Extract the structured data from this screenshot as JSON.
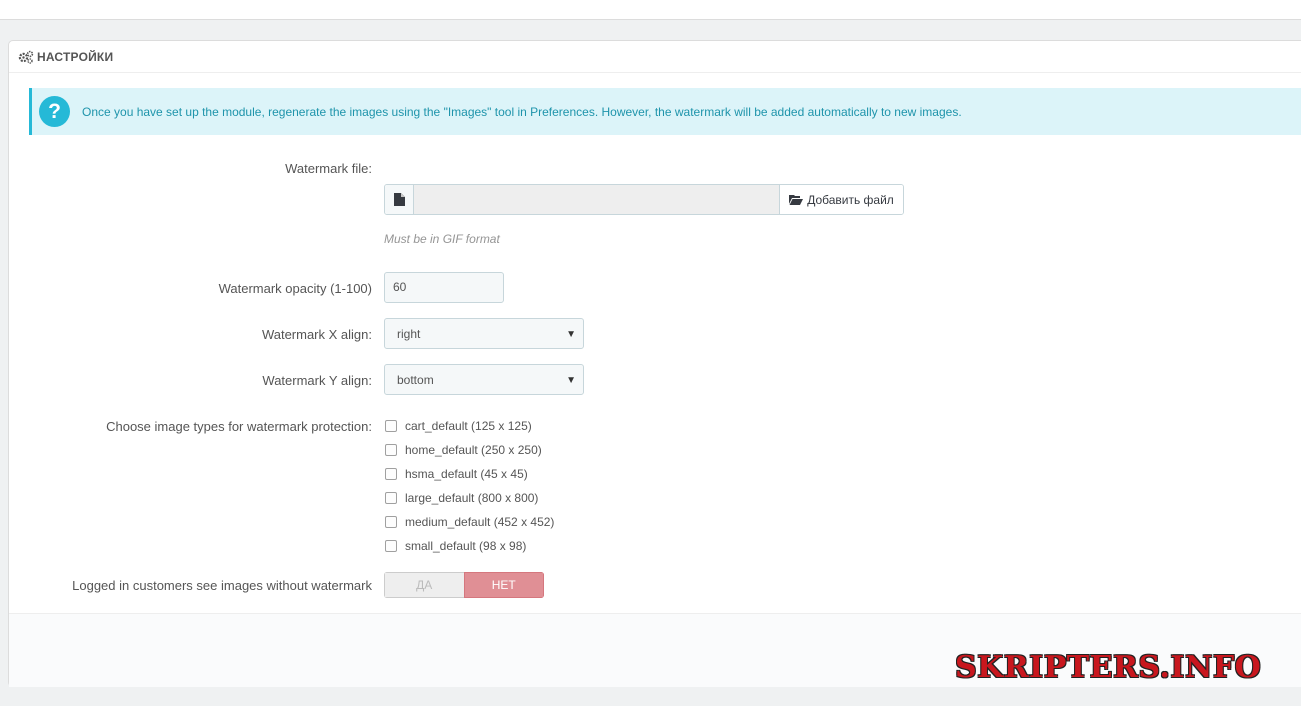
{
  "panel": {
    "title": "НАСТРОЙКИ",
    "icon": "gears-icon"
  },
  "alert": {
    "icon": "question-icon",
    "icon_glyph": "?",
    "text": "Once you have set up the module, regenerate the images using the \"Images\" tool in Preferences. However, the watermark will be added automatically to new images."
  },
  "form": {
    "watermark_file": {
      "label": "Watermark file:",
      "button_label": "Добавить файл",
      "help": "Must be in GIF format"
    },
    "opacity": {
      "label": "Watermark opacity (1-100)",
      "value": "60"
    },
    "x_align": {
      "label": "Watermark X align:",
      "value": "right"
    },
    "y_align": {
      "label": "Watermark Y align:",
      "value": "bottom"
    },
    "image_types": {
      "label": "Choose image types for watermark protection:",
      "options": [
        {
          "label": "cart_default (125 x 125)",
          "checked": false
        },
        {
          "label": "home_default (250 x 250)",
          "checked": false
        },
        {
          "label": "hsma_default (45 x 45)",
          "checked": false
        },
        {
          "label": "large_default (800 x 800)",
          "checked": false
        },
        {
          "label": "medium_default (452 x 452)",
          "checked": false
        },
        {
          "label": "small_default (98 x 98)",
          "checked": false
        }
      ]
    },
    "logged_in": {
      "label": "Logged in customers see images without watermark",
      "yes_label": "ДА",
      "no_label": "НЕТ",
      "selected": "НЕТ"
    }
  },
  "watermark_text": "SKRIPTERS.INFO",
  "colors": {
    "accent": "#25b9d7",
    "alert_bg": "#dcf4f9",
    "switch_on": "#e08f95"
  }
}
